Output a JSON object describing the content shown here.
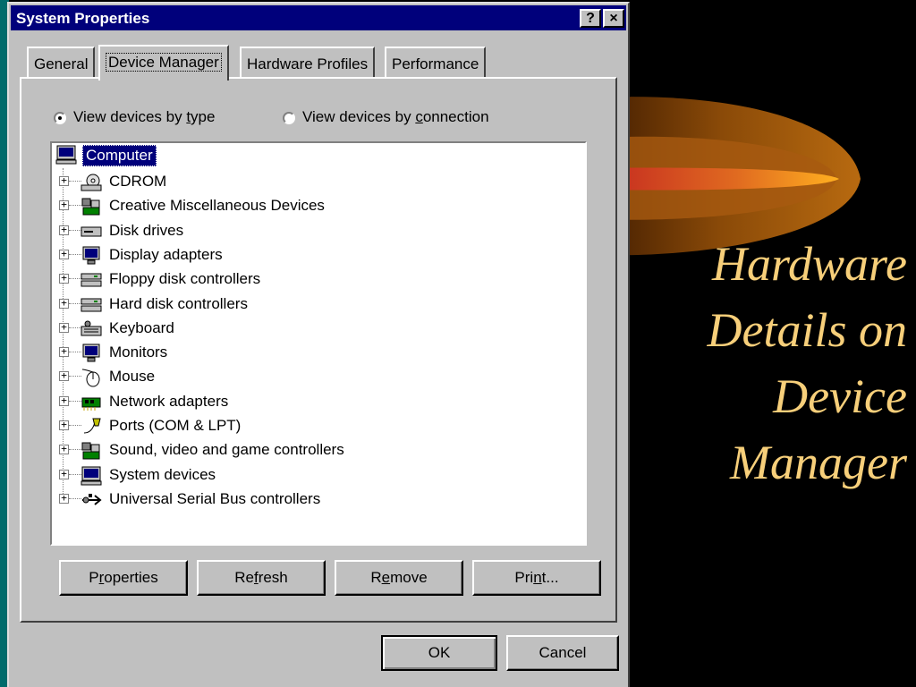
{
  "window": {
    "title": "System Properties",
    "help_glyph": "?",
    "close_glyph": "×"
  },
  "tabs": [
    {
      "label": "General"
    },
    {
      "label": "Device Manager"
    },
    {
      "label": "Hardware Profiles"
    },
    {
      "label": "Performance"
    }
  ],
  "view_options": {
    "by_type": {
      "pre": "View devices by ",
      "key": "t",
      "post": "ype",
      "checked": true
    },
    "by_connection": {
      "pre": "View devices by ",
      "key": "c",
      "post": "onnection",
      "checked": false
    }
  },
  "tree": {
    "root": {
      "label": "Computer",
      "icon": "computer-icon"
    },
    "items": [
      {
        "label": "CDROM",
        "icon": "cdrom-icon"
      },
      {
        "label": "Creative Miscellaneous Devices",
        "icon": "multimedia-icon"
      },
      {
        "label": "Disk drives",
        "icon": "disk-drive-icon"
      },
      {
        "label": "Display adapters",
        "icon": "monitor-icon"
      },
      {
        "label": "Floppy disk controllers",
        "icon": "controller-icon"
      },
      {
        "label": "Hard disk controllers",
        "icon": "controller-icon"
      },
      {
        "label": "Keyboard",
        "icon": "keyboard-icon"
      },
      {
        "label": "Monitors",
        "icon": "monitor-icon"
      },
      {
        "label": "Mouse",
        "icon": "mouse-icon"
      },
      {
        "label": "Network adapters",
        "icon": "network-card-icon"
      },
      {
        "label": "Ports (COM & LPT)",
        "icon": "port-icon"
      },
      {
        "label": "Sound, video and game controllers",
        "icon": "multimedia-icon"
      },
      {
        "label": "System devices",
        "icon": "computer-icon"
      },
      {
        "label": "Universal Serial Bus controllers",
        "icon": "usb-icon"
      }
    ]
  },
  "buttons": {
    "properties": {
      "pre": "P",
      "key": "r",
      "post": "operties"
    },
    "refresh": {
      "pre": "Re",
      "key": "f",
      "post": "resh"
    },
    "remove": {
      "pre": "R",
      "key": "e",
      "post": "move"
    },
    "print": {
      "pre": "Pri",
      "key": "n",
      "post": "t..."
    },
    "ok": "OK",
    "cancel": "Cancel"
  },
  "slide": {
    "title_lines": [
      "Hardware",
      "Details on",
      "Device",
      "Manager"
    ],
    "title_color": "#f7cf7a"
  },
  "colors": {
    "titlebar": "#00007b",
    "dialog_face": "#c0c0c0",
    "selection": "#00007b",
    "background": "#000000"
  }
}
